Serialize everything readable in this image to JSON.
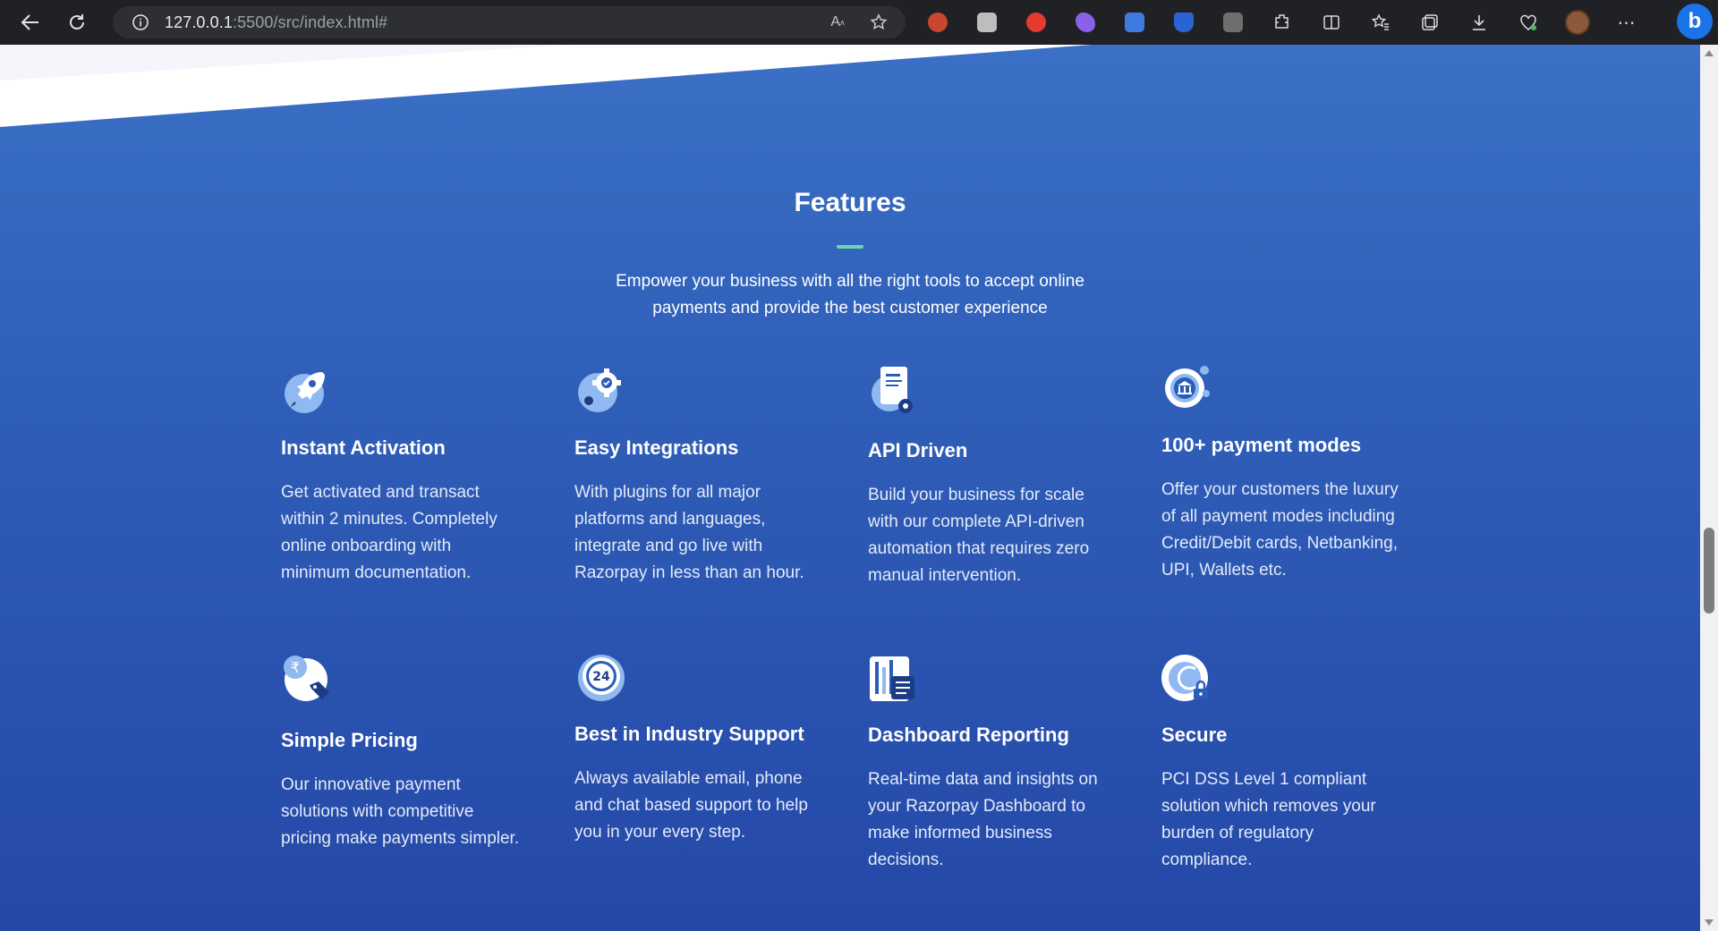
{
  "browser": {
    "url_host": "127.0.0.1",
    "url_rest": ":5500/src/index.html#"
  },
  "section": {
    "title": "Features",
    "subtitle": "Empower your business with all the right tools to accept online payments and provide the best customer experience"
  },
  "features": [
    {
      "title": "Instant Activation",
      "description": "Get activated and transact within 2 minutes. Completely online onboarding with minimum documentation.",
      "icon": "rocket-icon"
    },
    {
      "title": "Easy Integrations",
      "description": "With plugins for all major platforms and languages, integrate and go live with Razorpay in less than an hour.",
      "icon": "gear-icon"
    },
    {
      "title": "API Driven",
      "description": "Build your business for scale with our complete API-driven automation that requires zero manual intervention.",
      "icon": "document-icon"
    },
    {
      "title": "100+ payment modes",
      "description": "Offer your customers the luxury of all payment modes including Credit/Debit cards, Netbanking, UPI, Wallets etc.",
      "icon": "bank-icon"
    },
    {
      "title": "Simple Pricing",
      "description": "Our innovative payment solutions with competitive pricing make payments simpler.",
      "icon": "rupee-tag-icon"
    },
    {
      "title": "Best in Industry Support",
      "description": "Always available email, phone and chat based support to help you in your every step.",
      "icon": "support-24-icon",
      "icon_text": "24"
    },
    {
      "title": "Dashboard Reporting",
      "description": "Real-time data and insights on your Razorpay Dashboard to make informed business decisions.",
      "icon": "dashboard-icon"
    },
    {
      "title": "Secure",
      "description": "PCI DSS Level 1 compliant solution which removes your burden of regulatory compliance.",
      "icon": "lock-icon"
    }
  ],
  "colors": {
    "accent_line": "#6fd3b0",
    "background_top": "#3b70c6",
    "background_bottom": "#2548a8"
  }
}
